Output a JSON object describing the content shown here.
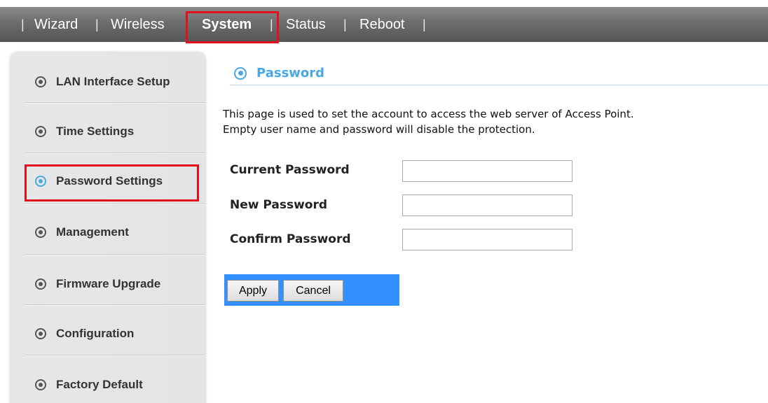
{
  "nav": {
    "items": [
      {
        "label": "Wizard"
      },
      {
        "label": "Wireless"
      },
      {
        "label": "System"
      },
      {
        "label": "Status"
      },
      {
        "label": "Reboot"
      }
    ],
    "separator": "|",
    "active": "System"
  },
  "sidebar": {
    "items": [
      {
        "label": "LAN Interface Setup"
      },
      {
        "label": "Time Settings"
      },
      {
        "label": "Password Settings"
      },
      {
        "label": "Management"
      },
      {
        "label": "Firmware Upgrade"
      },
      {
        "label": "Configuration"
      },
      {
        "label": "Factory Default"
      }
    ],
    "active": "Password Settings"
  },
  "main": {
    "title": "Password",
    "description_line1": "This page is used to set the account to access the web server of Access Point.",
    "description_line2": "Empty user name and password will disable the protection.",
    "fields": [
      {
        "label": "Current Password",
        "value": ""
      },
      {
        "label": "New Password",
        "value": ""
      },
      {
        "label": "Confirm Password",
        "value": ""
      }
    ],
    "apply_label": "Apply",
    "cancel_label": "Cancel"
  },
  "colors": {
    "accent": "#4aa8e0",
    "highlight": "#e3101b",
    "button_bar": "#3391ff"
  }
}
